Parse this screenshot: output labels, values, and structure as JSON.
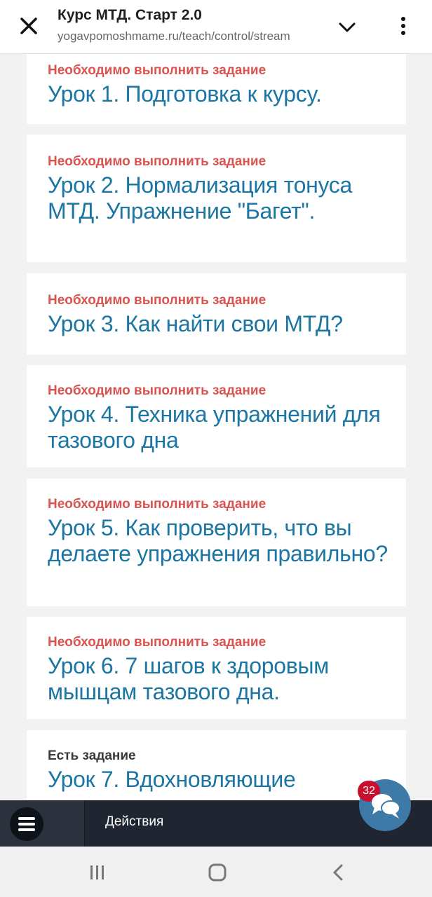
{
  "browser": {
    "title": "Курс МТД. Старт 2.0",
    "url": "yogavpomoshmame.ru/teach/control/stream"
  },
  "lessons": [
    {
      "status": "Необходимо выполнить задание",
      "title": "Урок 1. Подготовка к курсу."
    },
    {
      "status": "Необходимо выполнить задание",
      "title": "Урок 2. Нормализация тонуса МТД. Упражнение \"Багет\"."
    },
    {
      "status": "Необходимо выполнить задание",
      "title": "Урок 3. Как найти свои МТД?"
    },
    {
      "status": "Необходимо выполнить задание",
      "title": "Урок 4. Техника упражнений для тазового дна"
    },
    {
      "status": "Необходимо выполнить задание",
      "title": "Урок 5. Как проверить, что вы делаете упражнения правильно?"
    },
    {
      "status": "Необходимо выполнить задание",
      "title": "Урок 6. 7 шагов к здоровым мышцам тазового дна."
    },
    {
      "status": "Есть задание",
      "title": "Урок 7. Вдохновляющие"
    }
  ],
  "actions": {
    "label": "Действия"
  },
  "chat": {
    "badge": "32"
  },
  "colors": {
    "status_required": "#d9534f",
    "lesson_title": "#1b76a3",
    "actions_bar": "#1f2631",
    "chat_button": "#3d7aa8"
  }
}
